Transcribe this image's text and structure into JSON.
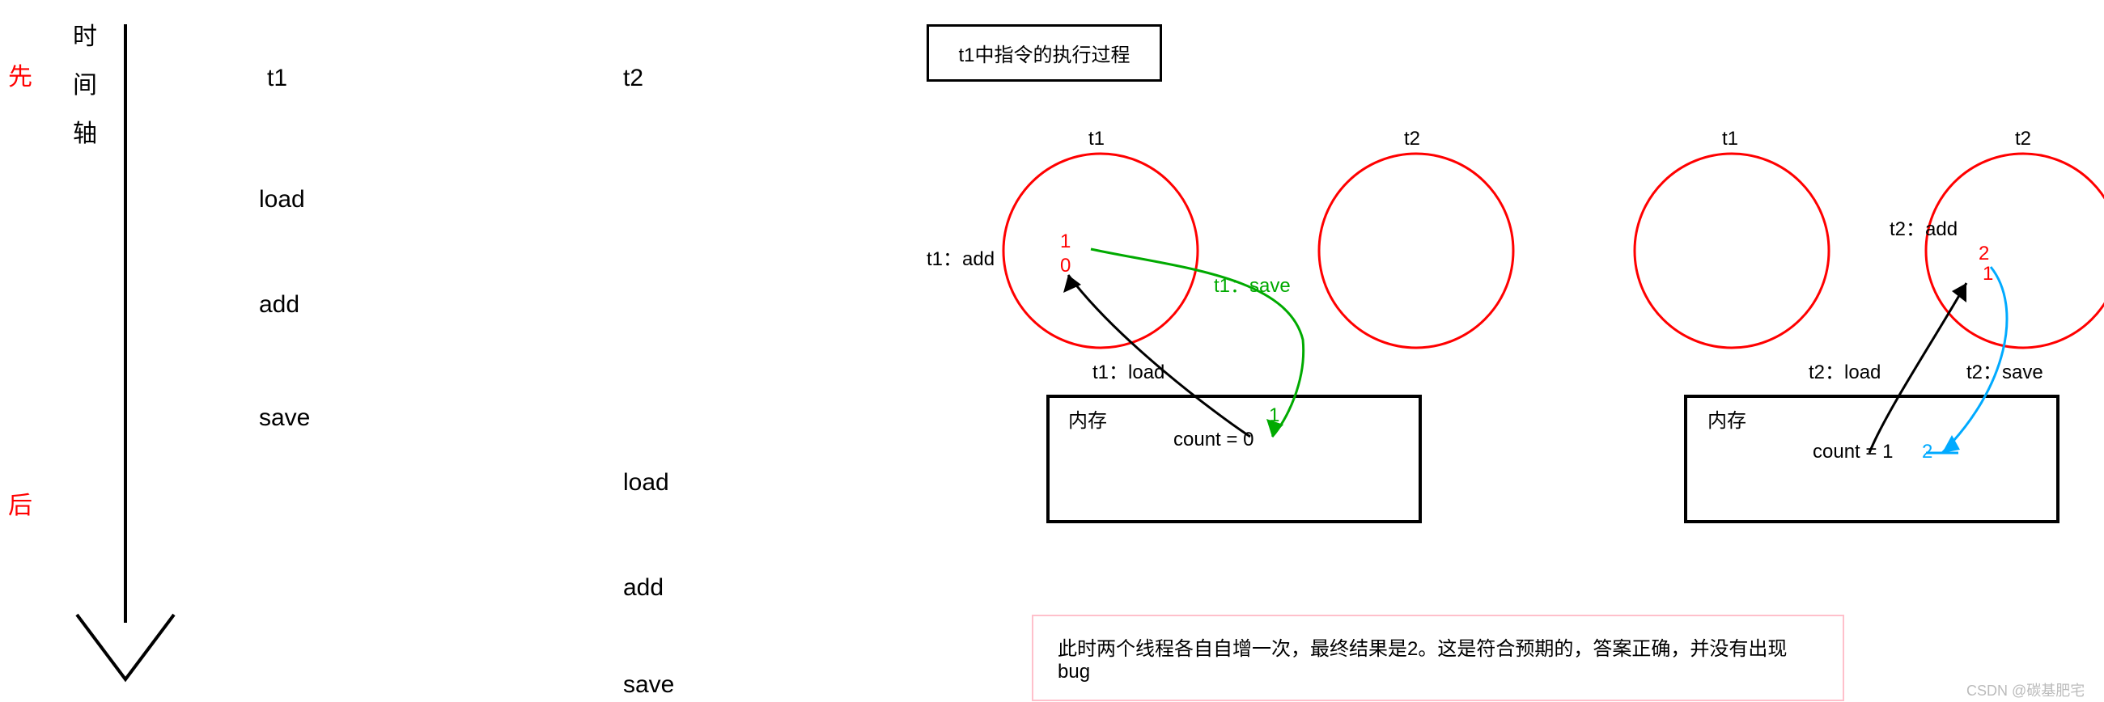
{
  "timeline": {
    "先": "先",
    "后": "后",
    "label_vertical": [
      "时",
      "间",
      "轴"
    ],
    "column_t1_header": "t1",
    "column_t2_header": "t2",
    "t1_ops": [
      "load",
      "add",
      "save"
    ],
    "t2_ops": [
      "load",
      "add",
      "save"
    ]
  },
  "process_title": "t1中指令的执行过程",
  "group1": {
    "t1_label": "t1",
    "t2_label": "t2",
    "t1_add": "t1：add",
    "t1_load": "t1：load",
    "t1_save": "t1：save",
    "memory_label": "内存",
    "count_label": "count = 0",
    "red_1": "1",
    "red_0": "0",
    "green_1": "1"
  },
  "group2": {
    "t1_label": "t1",
    "t2_label": "t2",
    "t2_add": "t2：add",
    "t2_load": "t2：load",
    "t2_save": "t2：save",
    "memory_label": "内存",
    "count_label": "count = 1",
    "red_2": "2",
    "red_1": "1",
    "blue_2": "2"
  },
  "summary": "此时两个线程各自自增一次，最终结果是2。这是符合预期的，答案正确，并没有出现 bug",
  "watermark": "CSDN @碳基肥宅"
}
